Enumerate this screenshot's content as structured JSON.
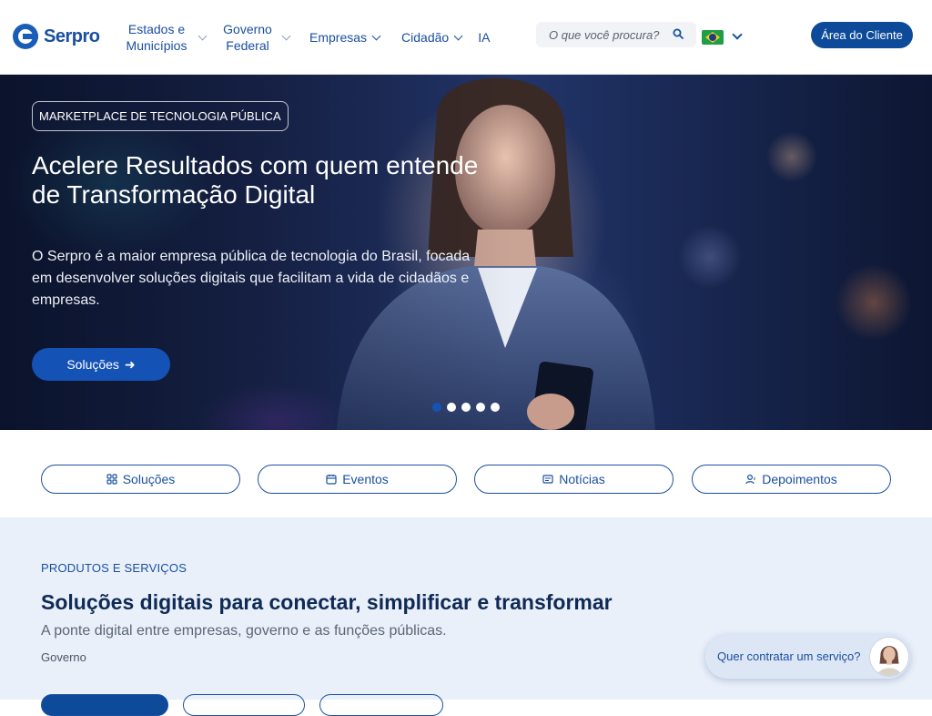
{
  "header": {
    "logo_text": "Serpro",
    "nav": [
      {
        "label": "Estados e\nMunicípios"
      },
      {
        "label": "Governo\nFederal"
      },
      {
        "label": "Empresas"
      },
      {
        "label": "Cidadão"
      },
      {
        "label": "IA"
      }
    ],
    "search_placeholder": "O que você procura?",
    "client_button": "Área do Cliente"
  },
  "hero": {
    "badge": "MARKETPLACE DE TECNOLOGIA PÚBLICA",
    "title": "Acelere Resultados com quem entende de Transformação Digital",
    "description": "O Serpro é a maior empresa pública de tecnologia do Brasil, focada em desenvolver soluções digitais que facilitam a vida de cidadãos e empresas.",
    "button": "Soluções",
    "slides": 5,
    "active_slide": 1
  },
  "quick_links": [
    {
      "label": "Soluções",
      "icon": "grid-icon"
    },
    {
      "label": "Eventos",
      "icon": "calendar-icon"
    },
    {
      "label": "Notícias",
      "icon": "news-icon"
    },
    {
      "label": "Depoimentos",
      "icon": "user-testimonial-icon"
    }
  ],
  "products": {
    "eyebrow": "PRODUTOS E SERVIÇOS",
    "title": "Soluções digitais para conectar, simplificar e transformar",
    "subtitle": "A ponte digital entre empresas, governo e as funções públicas.",
    "category": "Governo"
  },
  "chat": {
    "label": "Quer contratar um serviço?"
  },
  "colors": {
    "primary": "#0d4a9a",
    "accent": "#1552b5",
    "section_bg": "#e9f0fa"
  }
}
